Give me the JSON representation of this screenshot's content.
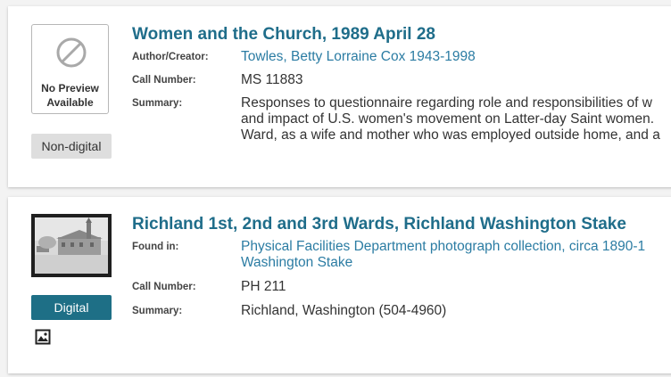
{
  "results": [
    {
      "title": "Women and the Church, 1989 April 28",
      "thumbnail_text_line1": "No Preview",
      "thumbnail_text_line2": "Available",
      "badge": "Non-digital",
      "fields": {
        "author_label": "Author/Creator:",
        "author_value": "Towles, Betty Lorraine Cox 1943-1998",
        "call_label": "Call Number:",
        "call_value": "MS 11883",
        "summary_label": "Summary:",
        "summary_lines": [
          "Responses to questionnaire regarding role and responsibilities of w",
          "and impact of U.S. women's movement on Latter-day Saint women.",
          "Ward, as a wife and mother who was employed outside home, and a"
        ]
      }
    },
    {
      "title": "Richland 1st, 2nd and 3rd Wards, Richland Washington Stake",
      "badge": "Digital",
      "fields": {
        "found_label": "Found in:",
        "found_lines": [
          "Physical Facilities Department photograph collection, circa 1890-1",
          "Washington Stake"
        ],
        "call_label": "Call Number:",
        "call_value": "PH 211",
        "summary_label": "Summary:",
        "summary_value": "Richland, Washington (504-4960)"
      }
    }
  ],
  "icons": {
    "no_preview": "prohibited-circle-icon",
    "image": "image-icon"
  },
  "colors": {
    "title": "#1f6d8a",
    "link": "#2b7ca3",
    "digital_badge": "#1e6f86",
    "nondigital_badge": "#dedede"
  }
}
